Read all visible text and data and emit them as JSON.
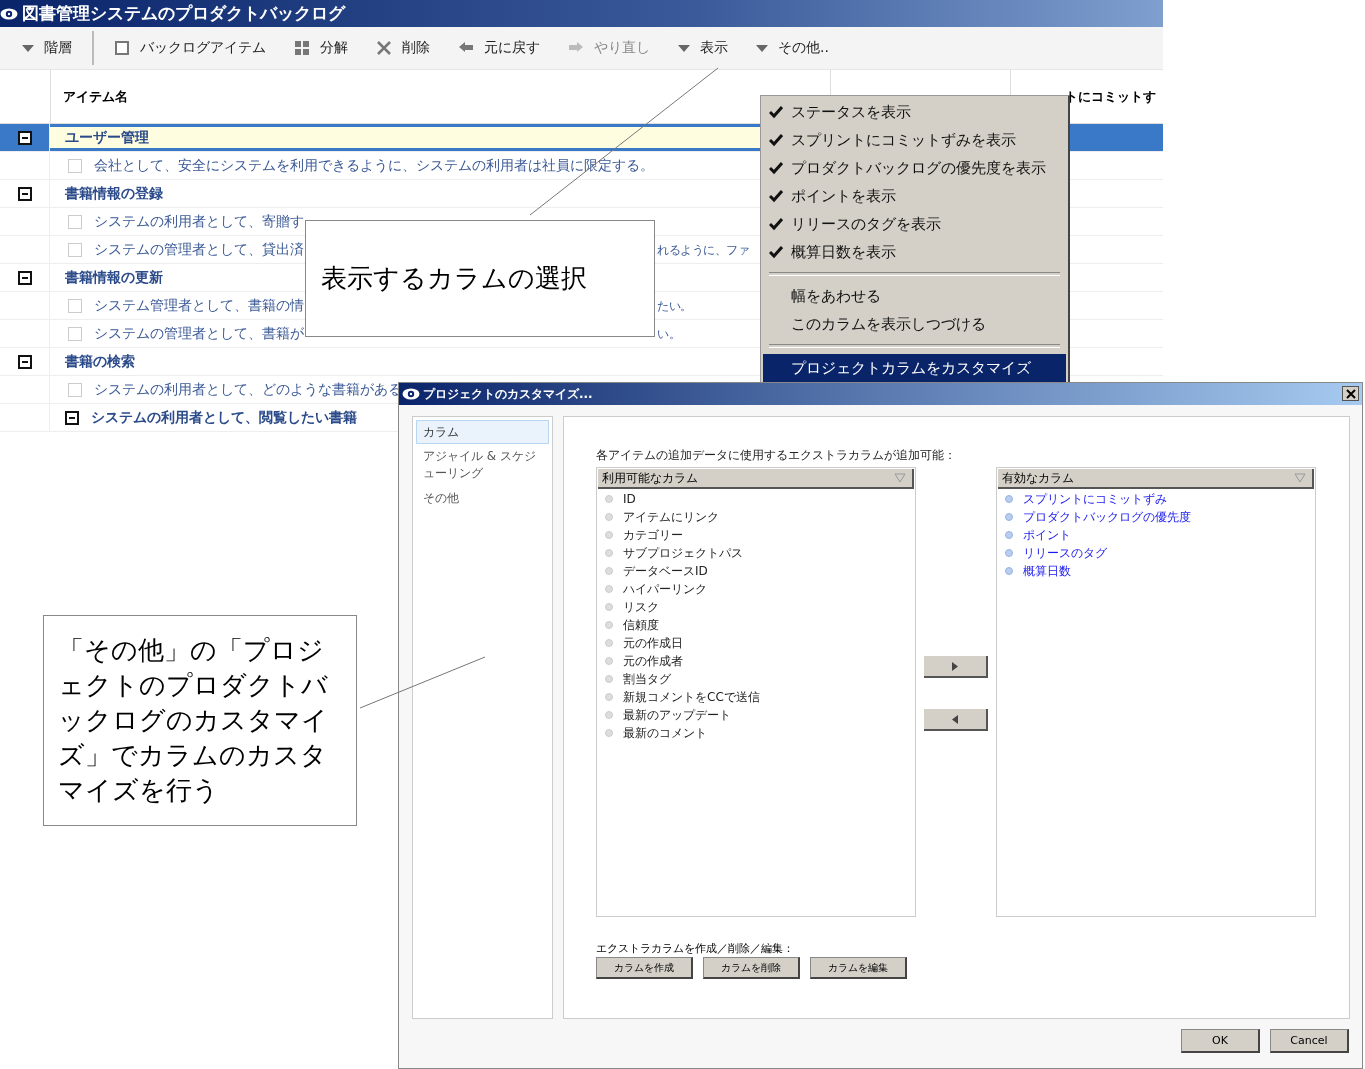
{
  "window": {
    "title": "図書管理システムのプロダクトバックログ"
  },
  "toolbar": [
    {
      "kind": "dropdown",
      "label": "階層",
      "disabled": false
    },
    {
      "kind": "separator"
    },
    {
      "kind": "add",
      "label": "バックログアイテム",
      "disabled": false
    },
    {
      "kind": "split",
      "label": "分解",
      "disabled": false
    },
    {
      "kind": "delete",
      "label": "削除",
      "disabled": false
    },
    {
      "kind": "undo",
      "label": "元に戻す",
      "disabled": false
    },
    {
      "kind": "redo",
      "label": "やり直し",
      "disabled": true
    },
    {
      "kind": "dropdown",
      "label": "表示",
      "disabled": false
    },
    {
      "kind": "dropdown",
      "label": "その他..",
      "disabled": false
    }
  ],
  "table": {
    "columns": [
      {
        "label": "アイテム名"
      },
      {
        "label": "トにコミットす"
      }
    ],
    "rows": [
      {
        "kind": "group",
        "text": "ユーザー管理",
        "expanded": true,
        "selected": true
      },
      {
        "kind": "story",
        "text": "会社として、安全にシステムを利用できるように、システムの利用者は社員に限定する。",
        "checked": false,
        "selected": false
      },
      {
        "kind": "group",
        "text": "書籍情報の登録",
        "expanded": true,
        "selected": false
      },
      {
        "kind": "story",
        "text": "システムの利用者として、寄贈す",
        "checked": false,
        "selected": false
      },
      {
        "kind": "story",
        "text": "システムの管理者として、貸出済",
        "tail": "れるように、ファ",
        "checked": false,
        "selected": false
      },
      {
        "kind": "group",
        "text": "書籍情報の更新",
        "expanded": true,
        "selected": false
      },
      {
        "kind": "story",
        "text": "システム管理者として、書籍の情",
        "tail": "たい。",
        "checked": false,
        "selected": false
      },
      {
        "kind": "story",
        "text": "システムの管理者として、書籍が",
        "tail": "い。",
        "checked": false,
        "selected": false
      },
      {
        "kind": "group",
        "text": "書籍の検索",
        "expanded": true,
        "selected": false
      },
      {
        "kind": "story",
        "text": "システムの利用者として、どのような書籍がある",
        "checked": false,
        "selected": false
      },
      {
        "kind": "substory",
        "text": "システムの利用者として、閲覧したい書籍",
        "expanded": true,
        "selected": false
      }
    ]
  },
  "menu": {
    "groups": [
      [
        {
          "label": "ステータスを表示",
          "checked": true,
          "selected": false
        },
        {
          "label": "スプリントにコミットずみを表示",
          "checked": true,
          "selected": false
        },
        {
          "label": "プロダクトバックログの優先度を表示",
          "checked": true,
          "selected": false
        },
        {
          "label": "ポイントを表示",
          "checked": true,
          "selected": false
        },
        {
          "label": "リリースのタグを表示",
          "checked": true,
          "selected": false
        },
        {
          "label": "概算日数を表示",
          "checked": true,
          "selected": false
        }
      ],
      [
        {
          "label": "幅をあわせる",
          "checked": false,
          "selected": false
        },
        {
          "label": "このカラムを表示しつづける",
          "checked": false,
          "selected": false
        }
      ],
      [
        {
          "label": "プロジェクトカラムをカスタマイズ",
          "checked": false,
          "selected": true
        }
      ]
    ]
  },
  "callouts": [
    {
      "text": "表示するカラムの選択"
    },
    {
      "text": "「その他」の「プロジェクトのプロダクトバックログのカスタマイズ」でカラムのカスタマイズを行う"
    }
  ],
  "dialog": {
    "title": "プロジェクトのカスタマイズ...",
    "nav": [
      {
        "label": "カラム",
        "selected": true
      },
      {
        "label": "アジャイル & スケジューリング",
        "selected": false
      },
      {
        "label": "その他",
        "selected": false
      }
    ],
    "intro": "各アイテムの追加データに使用するエクストラカラムが追加可能：",
    "available": {
      "header": "利用可能なカラム",
      "items": [
        "ID",
        "アイテムにリンク",
        "カテゴリー",
        "サブプロジェクトパス",
        "データベースID",
        "ハイパーリンク",
        "リスク",
        "信頼度",
        "元の作成日",
        "元の作成者",
        "割当タグ",
        "新規コメントをCCで送信",
        "最新のアップデート",
        "最新のコメント"
      ]
    },
    "active": {
      "header": "有効なカラム",
      "items": [
        "スプリントにコミットずみ",
        "プロダクトバックログの優先度",
        "ポイント",
        "リリースのタグ",
        "概算日数"
      ]
    },
    "extra_label": "エクストラカラムを作成／削除／編集：",
    "extra_buttons": [
      "カラムを作成",
      "カラムを削除",
      "カラムを編集"
    ],
    "buttons": [
      "OK",
      "Cancel"
    ]
  }
}
